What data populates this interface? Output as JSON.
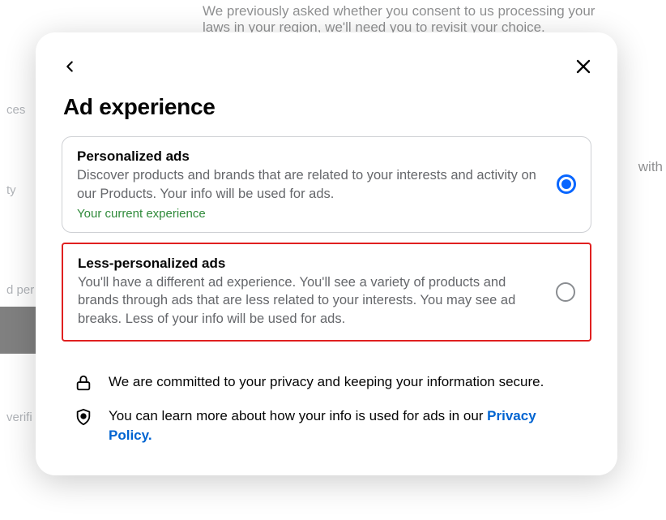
{
  "background": {
    "text_line1": "We previously asked whether you consent to us processing your",
    "text_line2": "laws in your region, we'll need you to revisit your choice.",
    "sidebar": {
      "item1": "ces",
      "item2": "ty",
      "item3": "d per",
      "item4": "verifi"
    },
    "right_tag": "with"
  },
  "modal": {
    "title": "Ad experience",
    "options": [
      {
        "title": "Personalized ads",
        "desc": "Discover products and brands that are related to your interests and activity on our Products. Your info will be used for ads.",
        "badge": "Your current experience",
        "selected": true
      },
      {
        "title": "Less-personalized ads",
        "desc": "You'll have a different ad experience. You'll see a variety of products and brands through ads that are less related to your interests. You may see ad breaks. Less of your info will be used for ads.",
        "selected": false
      }
    ],
    "info": {
      "privacy_commit": "We are committed to your privacy and keeping your information secure.",
      "privacy_learn": "You can learn more about how your info is used for ads in our ",
      "privacy_link": "Privacy Policy."
    }
  }
}
